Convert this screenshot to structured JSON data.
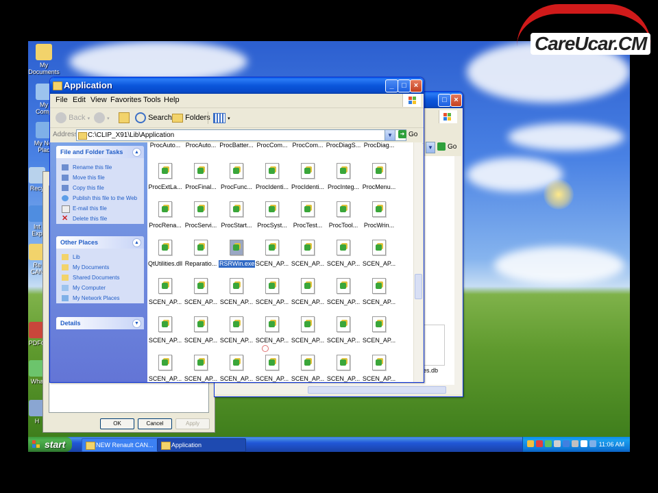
{
  "logo": {
    "text": "CareUcar.CM"
  },
  "desktop": {
    "icons": [
      {
        "label_1": "My",
        "label_2": "Documents"
      },
      {
        "label_1": "My",
        "label_2": "Comp"
      },
      {
        "label_1": "My Net",
        "label_2": "Plac"
      },
      {
        "label_1": "Recy",
        "label_2": ""
      },
      {
        "label_1": "Int",
        "label_2": "Exp"
      },
      {
        "label_1": "Re",
        "label_2": "CAN"
      },
      {
        "label_1": "PDFC",
        "label_2": ""
      },
      {
        "label_1": "Wha",
        "label_2": ""
      },
      {
        "label_1": "H",
        "label_2": ""
      }
    ]
  },
  "back_dialog": {
    "ok": "OK",
    "cancel": "Cancel",
    "apply": "Apply"
  },
  "back_window": {
    "go": "Go",
    "partial_file": "es.db"
  },
  "window": {
    "title": "Application",
    "menu": [
      "File",
      "Edit",
      "View",
      "Favorites",
      "Tools",
      "Help"
    ],
    "toolbar": {
      "back": "Back",
      "search": "Search",
      "folders": "Folders"
    },
    "address": {
      "label": "Address",
      "value": "C:\\CLIP_X91\\Lib\\Application",
      "go": "Go"
    },
    "tasks": {
      "file_folder_title": "File and Folder Tasks",
      "file_folder_items": [
        {
          "label": "Rename this file",
          "icon": "rename-icon"
        },
        {
          "label": "Move this file",
          "icon": "move-icon"
        },
        {
          "label": "Copy this file",
          "icon": "copy-icon"
        },
        {
          "label": "Publish this file to the Web",
          "icon": "publish-icon"
        },
        {
          "label": "E-mail this file",
          "icon": "email-icon"
        },
        {
          "label": "Delete this file",
          "icon": "delete-icon"
        }
      ],
      "other_places_title": "Other Places",
      "other_places_items": [
        {
          "label": "Lib",
          "icon": "folder-icon"
        },
        {
          "label": "My Documents",
          "icon": "folder-icon"
        },
        {
          "label": "Shared Documents",
          "icon": "folder-icon"
        },
        {
          "label": "My Computer",
          "icon": "computer-icon"
        },
        {
          "label": "My Network Places",
          "icon": "network-icon"
        }
      ],
      "details_title": "Details"
    },
    "files": {
      "partial_top_row": [
        "ProcAuto...",
        "ProcAuto...",
        "ProcBatter...",
        "ProcCom...",
        "ProcCom...",
        "ProcDiagS...",
        "ProcDiag..."
      ],
      "rows": [
        [
          "ProcExtLa...",
          "ProcFinal...",
          "ProcFunc...",
          "ProcIdenti...",
          "ProcIdenti...",
          "ProcInteg...",
          "ProcMenu..."
        ],
        [
          "ProcRena...",
          "ProcServi...",
          "ProcStart...",
          "ProcSyst...",
          "ProcTest...",
          "ProcTool...",
          "ProcWrin..."
        ],
        [
          "QtUtilities.dll",
          "Reparatio...",
          "RSRWin.exe",
          "SCEN_AP...",
          "SCEN_AP...",
          "SCEN_AP...",
          "SCEN_AP..."
        ],
        [
          "SCEN_AP...",
          "SCEN_AP...",
          "SCEN_AP...",
          "SCEN_AP...",
          "SCEN_AP...",
          "SCEN_AP...",
          "SCEN_AP..."
        ],
        [
          "SCEN_AP...",
          "SCEN_AP...",
          "SCEN_AP...",
          "SCEN_AP...",
          "SCEN_AP...",
          "SCEN_AP...",
          "SCEN_AP..."
        ],
        [
          "SCEN_AP...",
          "SCEN_AP...",
          "SCEN_AP...",
          "SCEN_AP...",
          "SCEN_AP...",
          "SCEN_AP...",
          "SCEN_AP..."
        ]
      ],
      "selected": "RSRWin.exe",
      "selected_icon_text": "clip"
    }
  },
  "taskbar": {
    "start": "start",
    "tasks": [
      "NEW Renault CAN...",
      "Application"
    ],
    "clock": "11:06 AM"
  },
  "colors": {
    "xp_blue": "#0b56db",
    "start_green": "#3a8f3a",
    "selection": "#316ac5"
  }
}
